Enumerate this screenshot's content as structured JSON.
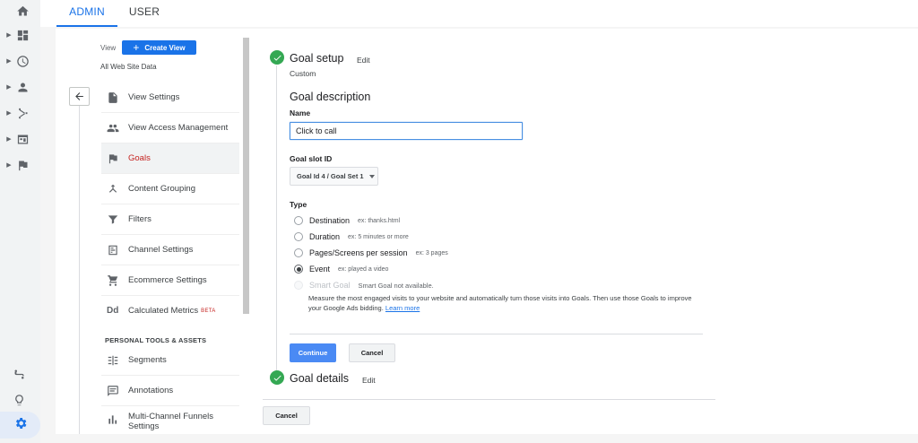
{
  "rail": {
    "icons": [
      "home-icon",
      "dashboard-icon",
      "clock-icon",
      "person-icon",
      "acquisition-icon",
      "behavior-icon",
      "flag-icon"
    ],
    "bottom_icons": [
      "route-icon",
      "lightbulb-icon",
      "gear-icon"
    ],
    "active_color": "#1a73e8"
  },
  "tabs": [
    {
      "label": "ADMIN",
      "active": true
    },
    {
      "label": "USER",
      "active": false
    }
  ],
  "view": {
    "label": "View",
    "create_button": "Create View",
    "selected_view": "All Web Site Data"
  },
  "menu": {
    "items": [
      {
        "label": "View Settings",
        "icon": "page-icon"
      },
      {
        "label": "View Access Management",
        "icon": "people-icon"
      },
      {
        "label": "Goals",
        "icon": "flag-icon",
        "active": true
      },
      {
        "label": "Content Grouping",
        "icon": "grouping-icon"
      },
      {
        "label": "Filters",
        "icon": "filter-icon"
      },
      {
        "label": "Channel Settings",
        "icon": "channel-icon"
      },
      {
        "label": "Ecommerce Settings",
        "icon": "cart-icon"
      },
      {
        "label": "Calculated Metrics",
        "icon": "dd-icon",
        "badge": "BETA"
      }
    ],
    "section_title": "PERSONAL TOOLS & ASSETS",
    "personal_items": [
      {
        "label": "Segments",
        "icon": "segments-icon"
      },
      {
        "label": "Annotations",
        "icon": "annotation-icon"
      },
      {
        "label": "Multi-Channel Funnels Settings",
        "icon": "bar-chart-icon"
      }
    ]
  },
  "goal": {
    "setup": {
      "title": "Goal setup",
      "edit": "Edit",
      "value": "Custom"
    },
    "description_heading": "Goal description",
    "name_label": "Name",
    "name_value": "Click to call",
    "slot_label": "Goal slot ID",
    "slot_value": "Goal Id 4 / Goal Set 1",
    "type_label": "Type",
    "types": [
      {
        "label": "Destination",
        "example": "ex: thanks.html",
        "checked": false
      },
      {
        "label": "Duration",
        "example": "ex: 5 minutes or more",
        "checked": false
      },
      {
        "label": "Pages/Screens per session",
        "example": "ex: 3 pages",
        "checked": false
      },
      {
        "label": "Event",
        "example": "ex: played a video",
        "checked": true
      }
    ],
    "smart_goal": {
      "label": "Smart Goal",
      "note": "Smart Goal not available.",
      "description": "Measure the most engaged visits to your website and automatically turn those visits into Goals. Then use those Goals to improve your Google Ads bidding.",
      "link": "Learn more"
    },
    "continue_button": "Continue",
    "cancel_button": "Cancel",
    "details": {
      "title": "Goal details",
      "edit": "Edit"
    },
    "bottom_cancel": "Cancel",
    "check_color": "#34a853"
  }
}
